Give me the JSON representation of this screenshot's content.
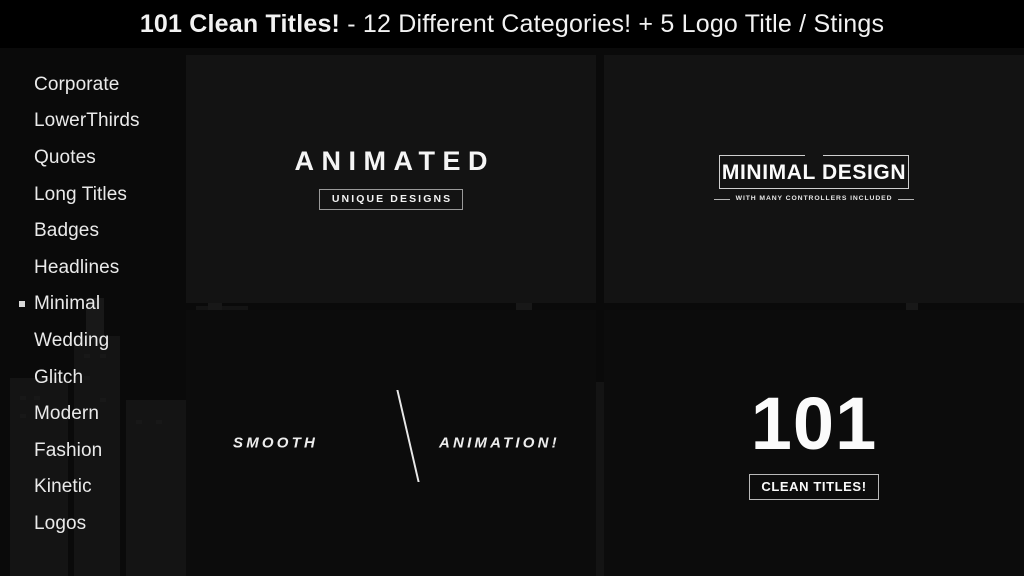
{
  "header": {
    "title_strong": "101 Clean Titles!",
    "title_rest": " - 12 Different Categories! + 5 Logo Title / Stings",
    "background_color": "#000000",
    "text_color": "#f2f2f2"
  },
  "sidebar": {
    "selected": "Minimal",
    "bullet_glyph": "square-bullet",
    "items": [
      {
        "label": "Corporate"
      },
      {
        "label": "LowerThirds"
      },
      {
        "label": "Quotes"
      },
      {
        "label": "Long Titles"
      },
      {
        "label": "Badges"
      },
      {
        "label": "Headlines"
      },
      {
        "label": "Minimal"
      },
      {
        "label": "Wedding"
      },
      {
        "label": "Glitch"
      },
      {
        "label": "Modern"
      },
      {
        "label": "Fashion"
      },
      {
        "label": "Kinetic"
      },
      {
        "label": "Logos"
      }
    ]
  },
  "previews": {
    "top_left": {
      "title": "ANIMATED",
      "subtitle": "UNIQUE DESIGNS"
    },
    "top_right": {
      "title": "MINIMAL  DESIGN",
      "subtitle": "WITH MANY  CONTROLLERS INCLUDED"
    },
    "bottom_left": {
      "word_left": "SMOOTH",
      "word_right": "ANIMATION!",
      "divider": "diagonal-slash"
    },
    "bottom_right": {
      "number": "101",
      "subtitle": "CLEAN TITLES!"
    }
  },
  "theme": {
    "page_background": "#0a0a0a",
    "panel_background": "#131313",
    "panel_background_lower": "#0c0c0c",
    "text_primary": "#f2f2f2",
    "rule_color": "#b4b4b4"
  }
}
